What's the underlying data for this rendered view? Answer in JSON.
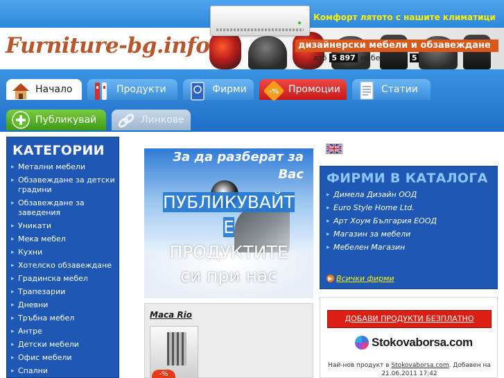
{
  "header": {
    "promo_text": "Комфорт лятото с нашите климатици",
    "logo_text": "Furniture-bg.info",
    "design_banner": "дизайнерски мебели и обзавеждане",
    "counter": {
      "prefix": "азб",
      "value": "5 897",
      "suffix": "мебели",
      "tail": "кти",
      "num2": "5"
    }
  },
  "nav": {
    "tabs": [
      {
        "label": "Начало",
        "icon": "home-icon"
      },
      {
        "label": "Продукти",
        "icon": "products-icon"
      },
      {
        "label": "Фирми",
        "icon": "firms-icon"
      },
      {
        "label": "Промоции",
        "icon": "percent-icon"
      },
      {
        "label": "Статии",
        "icon": "document-icon"
      },
      {
        "label": "Публикувай",
        "icon": "plus-icon"
      },
      {
        "label": "Линкове",
        "icon": "chain-link-icon"
      }
    ],
    "promo_badge": "-%"
  },
  "sidebar": {
    "title": "КАТЕГОРИИ",
    "items": [
      "Метални мебели",
      "Обзавеждане за детски градини",
      "Обзавеждане за заведения",
      "Уникати",
      "Мека мебел",
      "Кухни",
      "Хотелско обзавеждане",
      "Градинска мебел",
      "Трапезарии",
      "Дневни",
      "Тръбна мебел",
      "Антре",
      "Детски мебели",
      "Офис мебели",
      "Спални"
    ]
  },
  "banner": {
    "line1": "За да разберат за Вас",
    "line2": "ПУБЛИКУВАЙТ",
    "line3": "Е",
    "line4": "ПРОДУКТИТЕ",
    "line5": "си при нас"
  },
  "product": {
    "title": "Маса Rio",
    "sale_badge": "-%"
  },
  "firms": {
    "title": "ФИРМИ В КАТАЛОГА",
    "items": [
      "Димела Дизайн ООД",
      "Euro Style Home Ltd.",
      "Арт Хоум България ЕООД",
      "Магазин за мебели",
      "Мебелен Магазин"
    ],
    "all_link": "Всички фирми"
  },
  "right_box": {
    "add_button": "ДОБАВИ ПРОДУКТИ БЕЗПЛАТНО",
    "logo_name": "Stokovaborsa.com",
    "latest_prefix": "Най-нов продукт в",
    "latest_source": "Stokovaborsa.com",
    "latest_suffix": ". Добавен на",
    "latest_date": "21.06.2011 17:42"
  },
  "colors": {
    "nav_blue": "#1f6fc8",
    "box_blue": "#1e57b4",
    "accent_orange": "#d9571b",
    "promo_yellow": "#fff000",
    "button_red": "#dc1f12"
  }
}
